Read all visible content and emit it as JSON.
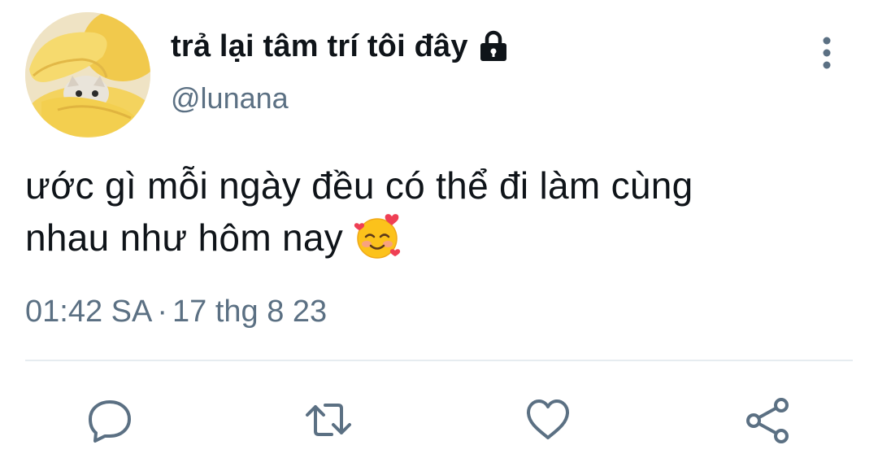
{
  "author": {
    "display_name": "trả lại tâm trí tôi đây",
    "handle": "@lunana",
    "avatar_icon": "cat-in-banana-avatar",
    "protected_icon": "lock-icon"
  },
  "tweet": {
    "lines": [
      "ước gì mỗi ngày đều có thể đi làm cùng",
      "nhau như hôm nay"
    ],
    "emoji": "smiling-face-with-hearts-emoji"
  },
  "meta": {
    "time": "01:42 SA",
    "separator": "·",
    "date": "17 thg 8 23"
  },
  "actions": {
    "reply_icon": "reply-icon",
    "retweet_icon": "retweet-icon",
    "like_icon": "heart-icon",
    "share_icon": "share-icon",
    "more_icon": "more-vertical-icon"
  },
  "colors": {
    "text_primary": "#0f1419",
    "text_secondary": "#5b7083",
    "divider": "#e6ecf0",
    "icon": "#5b7083"
  }
}
